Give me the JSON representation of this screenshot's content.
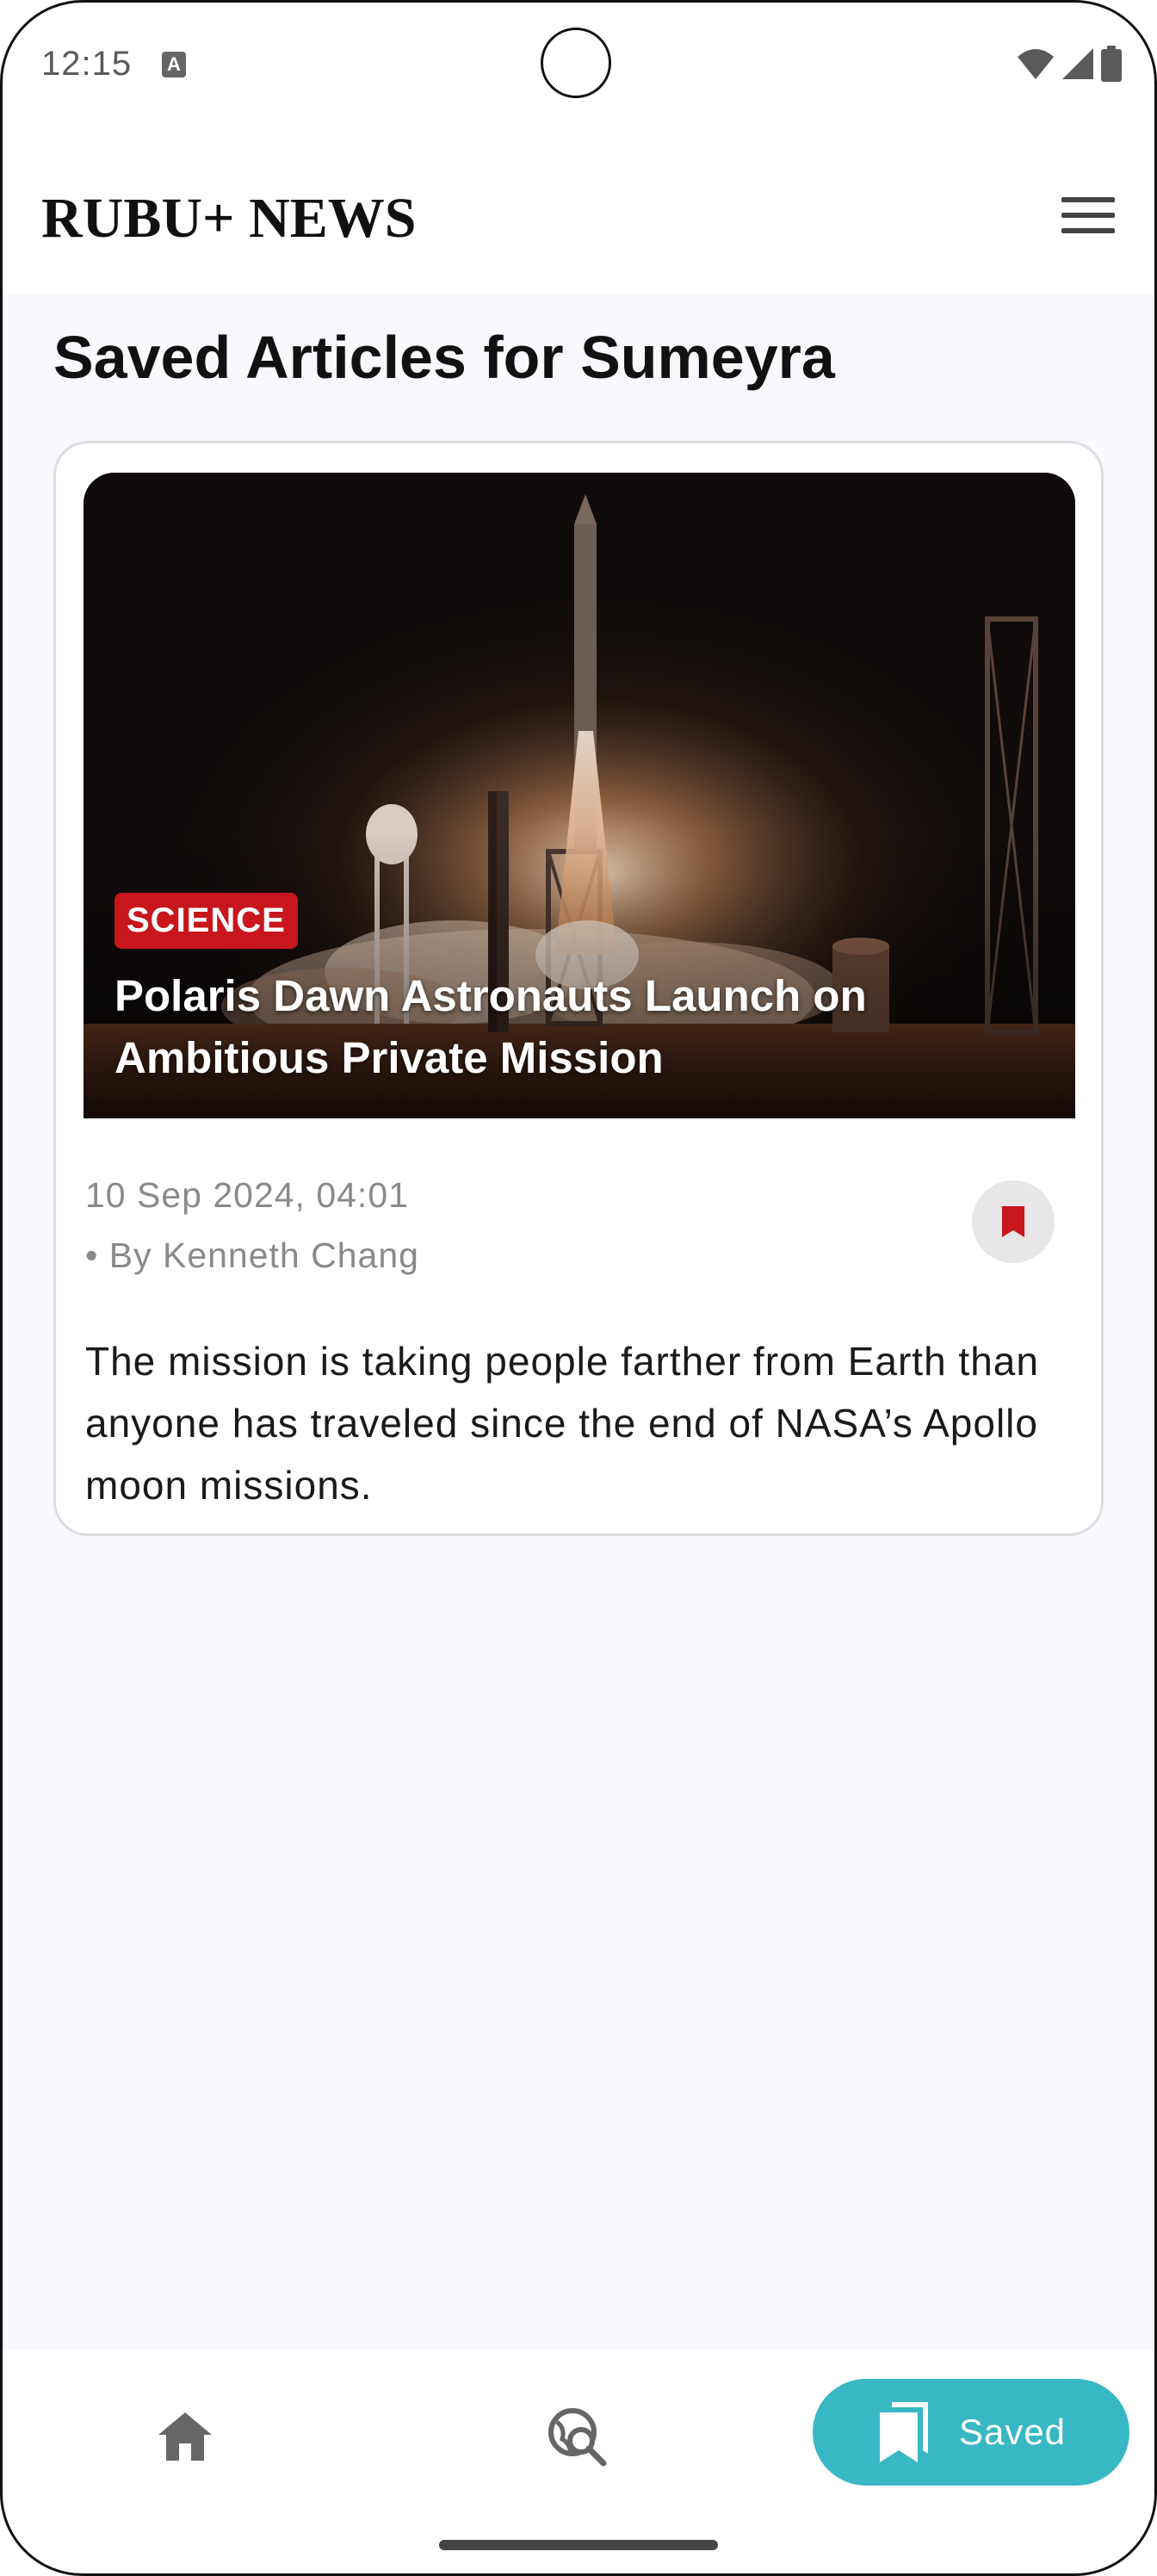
{
  "status_bar": {
    "time": "12:15",
    "notification_icon": "a-icon",
    "icons": [
      "wifi-icon",
      "signal-icon",
      "battery-icon"
    ]
  },
  "app_bar": {
    "logo": "RUBU+ NEWS",
    "menu_icon": "hamburger-menu-icon"
  },
  "page": {
    "title": "Saved Articles for Sumeyra"
  },
  "articles": [
    {
      "category": "SCIENCE",
      "headline": "Polaris Dawn Astronauts Launch on Ambitious Private Mission",
      "date": "10 Sep 2024, 04:01",
      "author": "• By Kenneth Chang",
      "summary": "The mission is taking people farther from Earth than anyone has traveled since the end of NASA’s Apollo moon missions.",
      "bookmark_icon": "bookmark-filled-icon",
      "image": "rocket-launch-image"
    }
  ],
  "bottom_nav": {
    "items": [
      {
        "icon": "home-icon",
        "label": ""
      },
      {
        "icon": "explore-search-icon",
        "label": ""
      },
      {
        "icon": "bookmark-icon",
        "label": "Saved"
      }
    ],
    "active_color": "#38b7c4"
  },
  "colors": {
    "accent": "#38b7c4",
    "badge": "#c8161d",
    "background": "#f9f9fd"
  }
}
